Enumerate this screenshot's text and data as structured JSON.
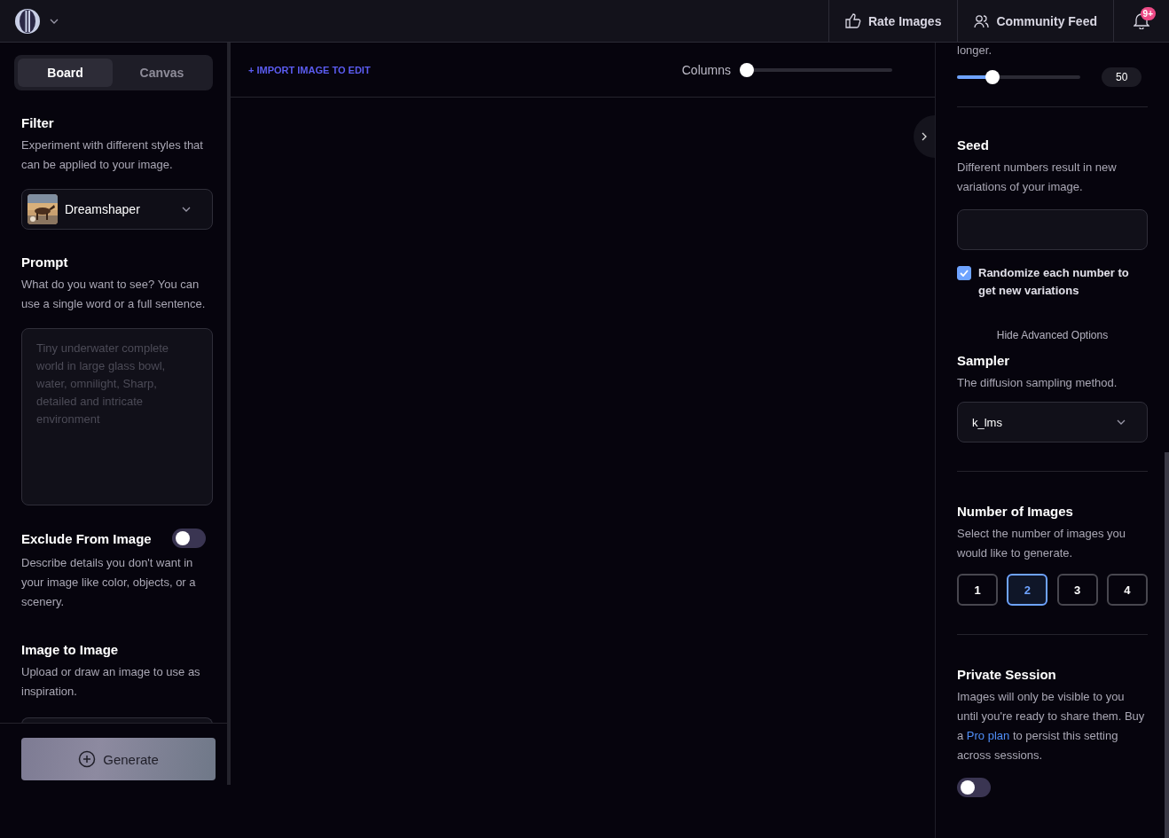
{
  "header": {
    "nav": [
      {
        "kind": "thumb",
        "label": "Rate Images"
      },
      {
        "kind": "people",
        "label": "Community Feed"
      }
    ],
    "notification_badge": "9+"
  },
  "left_panel": {
    "tabs": [
      {
        "label": "Board",
        "selected": true
      },
      {
        "label": "Canvas",
        "selected": false
      }
    ],
    "filter": {
      "title": "Filter",
      "description": "Experiment with different styles that can be applied to your image.",
      "model": "Dreamshaper"
    },
    "prompt": {
      "title": "Prompt",
      "description": "What do you want to see? You can use a single word or a full sentence.",
      "placeholder": "Tiny underwater complete world in large glass bowl, water, omnilight, Sharp, detailed and intricate environment"
    },
    "exclude": {
      "title": "Exclude From Image",
      "on": false,
      "description": "Describe details you don't want in your image like color, objects, or a scenery."
    },
    "image_to_image": {
      "title": "Image to Image",
      "description": "Upload or draw an image to use as inspiration."
    },
    "generate_button": "Generate"
  },
  "board": {
    "import_link": "+ IMPORT IMAGE TO EDIT",
    "columns": {
      "label": "Columns",
      "level": 0
    }
  },
  "right_panel": {
    "steps_tail": "longer.",
    "steps_slider": {
      "level": 0.29,
      "reading": "50"
    },
    "seed": {
      "title": "Seed",
      "description": "Different numbers result in new variations of your image.",
      "randomize": {
        "label": "Randomize each number to get new variations",
        "checked": true
      }
    },
    "advanced_toggle": "Hide Advanced Options",
    "sampler": {
      "title": "Sampler",
      "description": "The diffusion sampling method.",
      "value": "k_lms"
    },
    "number_of_images": {
      "title": "Number of Images",
      "description": "Select the number of images you would like to generate.",
      "options": [
        {
          "label": "1",
          "selected": false
        },
        {
          "label": "2",
          "selected": true
        },
        {
          "label": "3",
          "selected": false
        },
        {
          "label": "4",
          "selected": false
        }
      ]
    },
    "private_session": {
      "title": "Private Session",
      "description_before": "Images will only be visible to you until you're ready to share them. Buy a ",
      "link": "Pro plan",
      "description_after": " to persist this setting across sessions.",
      "on": false
    }
  }
}
